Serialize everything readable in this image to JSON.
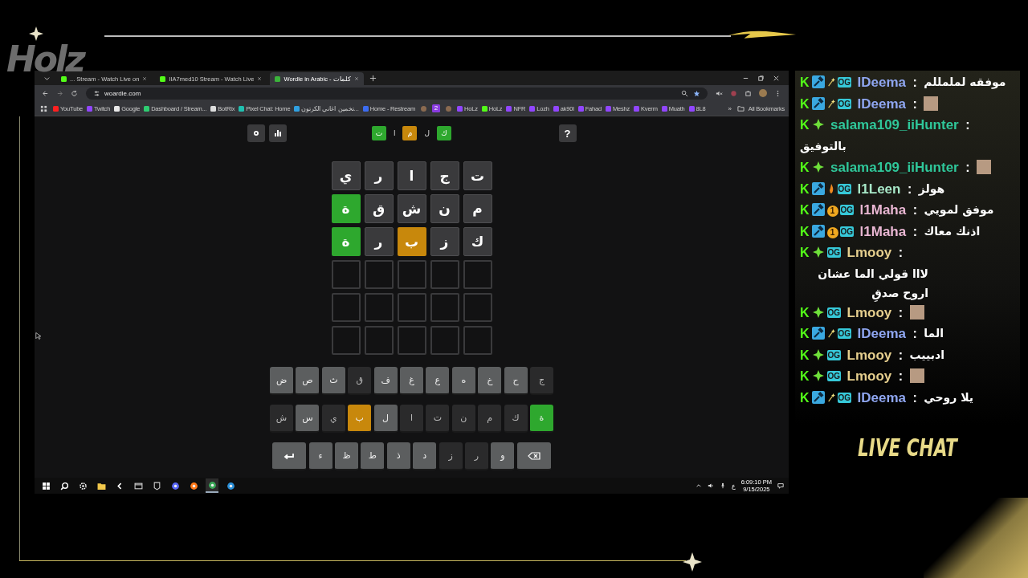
{
  "overlay": {
    "logo": "Holz",
    "caption": "LIVE CHAT"
  },
  "browser": {
    "tabs": [
      {
        "title": "... Stream - Watch Live on",
        "kind": "kick",
        "selected": false
      },
      {
        "title": "IIA7med10 Stream - Watch Live",
        "kind": "kick",
        "selected": false
      },
      {
        "title": "Wordle in Arabic - كلمات",
        "kind": "wordle",
        "selected": true
      }
    ],
    "address": "woardle.com",
    "bookmarks": [
      {
        "label": "YouTube",
        "kind": "youtube"
      },
      {
        "label": "Twitch",
        "kind": "twitch"
      },
      {
        "label": "Google",
        "kind": "google"
      },
      {
        "label": "Dashboard / Stream...",
        "kind": "dashboard"
      },
      {
        "label": "BotRix",
        "kind": "botrix"
      },
      {
        "label": "Pixel Chat: Home",
        "kind": "pixel"
      },
      {
        "label": "تخمين اغاني الكرتون...",
        "kind": "grid"
      },
      {
        "label": "Home - Restream",
        "kind": "restream"
      },
      {
        "kind": "avatar"
      },
      {
        "label": "2",
        "kind": "number"
      },
      {
        "kind": "avatar"
      },
      {
        "label": "HoLz",
        "kind": "twitch"
      },
      {
        "label": "HoLz",
        "kind": "kick"
      },
      {
        "label": "NFR",
        "kind": "twitch"
      },
      {
        "label": "Lozh",
        "kind": "twitch"
      },
      {
        "label": "ak90l",
        "kind": "twitch"
      },
      {
        "label": "Fahad",
        "kind": "twitch"
      },
      {
        "label": "Meshz",
        "kind": "twitch"
      },
      {
        "label": "Kverm",
        "kind": "twitch"
      },
      {
        "label": "Muath",
        "kind": "twitch"
      },
      {
        "label": "8L8",
        "kind": "twitch"
      }
    ],
    "more": "»",
    "all_bookmarks": "All Bookmarks"
  },
  "game": {
    "logo": [
      {
        "letter": "ك",
        "kind": "correct"
      },
      {
        "letter": "ل",
        "kind": "plain"
      },
      {
        "letter": "م",
        "kind": "present"
      },
      {
        "letter": "ا",
        "kind": "plain"
      },
      {
        "letter": "ت",
        "kind": "correct"
      }
    ],
    "help": "?",
    "grid": [
      [
        {
          "letter": "ت",
          "kind": "absent"
        },
        {
          "letter": "ج",
          "kind": "absent"
        },
        {
          "letter": "ا",
          "kind": "absent"
        },
        {
          "letter": "ر",
          "kind": "absent"
        },
        {
          "letter": "ي",
          "kind": "absent"
        }
      ],
      [
        {
          "letter": "م",
          "kind": "absent"
        },
        {
          "letter": "ن",
          "kind": "absent"
        },
        {
          "letter": "ش",
          "kind": "absent"
        },
        {
          "letter": "ق",
          "kind": "absent"
        },
        {
          "letter": "ة",
          "kind": "correct"
        }
      ],
      [
        {
          "letter": "ك",
          "kind": "absent"
        },
        {
          "letter": "ز",
          "kind": "absent"
        },
        {
          "letter": "ب",
          "kind": "present"
        },
        {
          "letter": "ر",
          "kind": "absent"
        },
        {
          "letter": "ة",
          "kind": "correct"
        }
      ],
      [
        {
          "kind": "empty"
        },
        {
          "kind": "empty"
        },
        {
          "kind": "empty"
        },
        {
          "kind": "empty"
        },
        {
          "kind": "empty"
        }
      ],
      [
        {
          "kind": "empty"
        },
        {
          "kind": "empty"
        },
        {
          "kind": "empty"
        },
        {
          "kind": "empty"
        },
        {
          "kind": "empty"
        }
      ],
      [
        {
          "kind": "empty"
        },
        {
          "kind": "empty"
        },
        {
          "kind": "empty"
        },
        {
          "kind": "empty"
        },
        {
          "kind": "empty"
        }
      ]
    ],
    "keyboard": [
      [
        {
          "letter": "ج",
          "kind": "absent"
        },
        {
          "letter": "ح",
          "kind": "unused"
        },
        {
          "letter": "خ",
          "kind": "unused"
        },
        {
          "letter": "ه",
          "kind": "unused"
        },
        {
          "letter": "ع",
          "kind": "unused"
        },
        {
          "letter": "غ",
          "kind": "unused"
        },
        {
          "letter": "ف",
          "kind": "unused"
        },
        {
          "letter": "ق",
          "kind": "absent"
        },
        {
          "letter": "ث",
          "kind": "unused"
        },
        {
          "letter": "ص",
          "kind": "unused"
        },
        {
          "letter": "ض",
          "kind": "unused"
        }
      ],
      [
        {
          "letter": "ة",
          "kind": "correct"
        },
        {
          "letter": "ك",
          "kind": "absent"
        },
        {
          "letter": "م",
          "kind": "absent"
        },
        {
          "letter": "ن",
          "kind": "absent"
        },
        {
          "letter": "ت",
          "kind": "absent"
        },
        {
          "letter": "ا",
          "kind": "absent"
        },
        {
          "letter": "ل",
          "kind": "unused"
        },
        {
          "letter": "ب",
          "kind": "present"
        },
        {
          "letter": "ي",
          "kind": "absent"
        },
        {
          "letter": "س",
          "kind": "unused"
        },
        {
          "letter": "ش",
          "kind": "absent"
        }
      ],
      [
        {
          "kind": "backspace"
        },
        {
          "letter": "و",
          "kind": "unused"
        },
        {
          "letter": "ر",
          "kind": "absent"
        },
        {
          "letter": "ز",
          "kind": "absent"
        },
        {
          "letter": "د",
          "kind": "unused"
        },
        {
          "letter": "ذ",
          "kind": "unused"
        },
        {
          "letter": "ط",
          "kind": "unused"
        },
        {
          "letter": "ظ",
          "kind": "unused"
        },
        {
          "letter": "ء",
          "kind": "unused"
        },
        {
          "kind": "enter"
        }
      ]
    ]
  },
  "taskbar": {
    "apps": [
      {
        "kind": "windows",
        "selected": false
      },
      {
        "kind": "search",
        "selected": false
      },
      {
        "kind": "gear",
        "selected": false
      },
      {
        "kind": "folder",
        "selected": false
      },
      {
        "kind": "arrow",
        "selected": false
      },
      {
        "kind": "window",
        "selected": false
      },
      {
        "kind": "shield",
        "selected": false
      },
      {
        "kind": "discord",
        "selected": false
      },
      {
        "kind": "firefox",
        "selected": false
      },
      {
        "kind": "chrome",
        "selected": true
      },
      {
        "kind": "steam",
        "selected": false
      }
    ],
    "language": "ع",
    "time": "6:09:10 PM",
    "date": "9/15/2025"
  },
  "chat": [
    {
      "user": "IDeema",
      "color": "#8fa6f0",
      "separator": ":",
      "badges": [
        {
          "kind": "kick",
          "label": "K"
        },
        {
          "kind": "mod"
        },
        {
          "kind": "wand"
        },
        {
          "kind": "og",
          "label": "OG"
        }
      ],
      "text": "موفقه لململلم"
    },
    {
      "user": "IDeema",
      "color": "#8fa6f0",
      "separator": ":",
      "badges": [
        {
          "kind": "kick",
          "label": "K"
        },
        {
          "kind": "mod"
        },
        {
          "kind": "wand"
        },
        {
          "kind": "og",
          "label": "OG"
        }
      ],
      "emote": true
    },
    {
      "user": "salama109_iiHunter",
      "color": "#2fc79a",
      "separator": ":",
      "badges": [
        {
          "kind": "kick",
          "label": "K"
        },
        {
          "kind": "diamond"
        }
      ],
      "text": "بالتوفيق"
    },
    {
      "user": "salama109_iiHunter",
      "color": "#2fc79a",
      "separator": ":",
      "badges": [
        {
          "kind": "kick",
          "label": "K"
        },
        {
          "kind": "diamond"
        }
      ],
      "emote": true
    },
    {
      "user": "l1Leen",
      "color": "#a8e8c8",
      "separator": ":",
      "badges": [
        {
          "kind": "kick",
          "label": "K"
        },
        {
          "kind": "mod"
        },
        {
          "kind": "flame"
        },
        {
          "kind": "og",
          "label": "OG"
        }
      ],
      "text": "هولز"
    },
    {
      "user": "l1Maha",
      "color": "#e8b6d2",
      "separator": ":",
      "badges": [
        {
          "kind": "kick",
          "label": "K"
        },
        {
          "kind": "mod"
        },
        {
          "kind": "sub",
          "label": "1"
        },
        {
          "kind": "og",
          "label": "OG"
        }
      ],
      "text": "موفق لمويي"
    },
    {
      "user": "l1Maha",
      "color": "#e8b6d2",
      "separator": ":",
      "badges": [
        {
          "kind": "kick",
          "label": "K"
        },
        {
          "kind": "mod"
        },
        {
          "kind": "sub",
          "label": "1"
        },
        {
          "kind": "og",
          "label": "OG"
        }
      ],
      "text": "اذنك معاك"
    },
    {
      "user": "Lmooy",
      "color": "#e6cf8e",
      "separator": ":",
      "badges": [
        {
          "kind": "kick",
          "label": "K"
        },
        {
          "kind": "diamond"
        },
        {
          "kind": "og",
          "label": "OG"
        }
      ],
      "text": "لااا قولي الما عشان اروح صدقِ"
    },
    {
      "user": "Lmooy",
      "color": "#e6cf8e",
      "separator": ":",
      "badges": [
        {
          "kind": "kick",
          "label": "K"
        },
        {
          "kind": "diamond"
        },
        {
          "kind": "og",
          "label": "OG"
        }
      ],
      "emote": true
    },
    {
      "user": "IDeema",
      "color": "#8fa6f0",
      "separator": ":",
      "badges": [
        {
          "kind": "kick",
          "label": "K"
        },
        {
          "kind": "mod"
        },
        {
          "kind": "wand"
        },
        {
          "kind": "og",
          "label": "OG"
        }
      ],
      "text": "الما"
    },
    {
      "user": "Lmooy",
      "color": "#e6cf8e",
      "separator": ":",
      "badges": [
        {
          "kind": "kick",
          "label": "K"
        },
        {
          "kind": "diamond"
        },
        {
          "kind": "og",
          "label": "OG"
        }
      ],
      "text": "ادبييب"
    },
    {
      "user": "Lmooy",
      "color": "#e6cf8e",
      "separator": ":",
      "badges": [
        {
          "kind": "kick",
          "label": "K"
        },
        {
          "kind": "diamond"
        },
        {
          "kind": "og",
          "label": "OG"
        }
      ],
      "emote": true
    },
    {
      "user": "IDeema",
      "color": "#8fa6f0",
      "separator": ":",
      "badges": [
        {
          "kind": "kick",
          "label": "K"
        },
        {
          "kind": "mod"
        },
        {
          "kind": "wand"
        },
        {
          "kind": "og",
          "label": "OG"
        }
      ],
      "text": "يلا روحي"
    }
  ]
}
